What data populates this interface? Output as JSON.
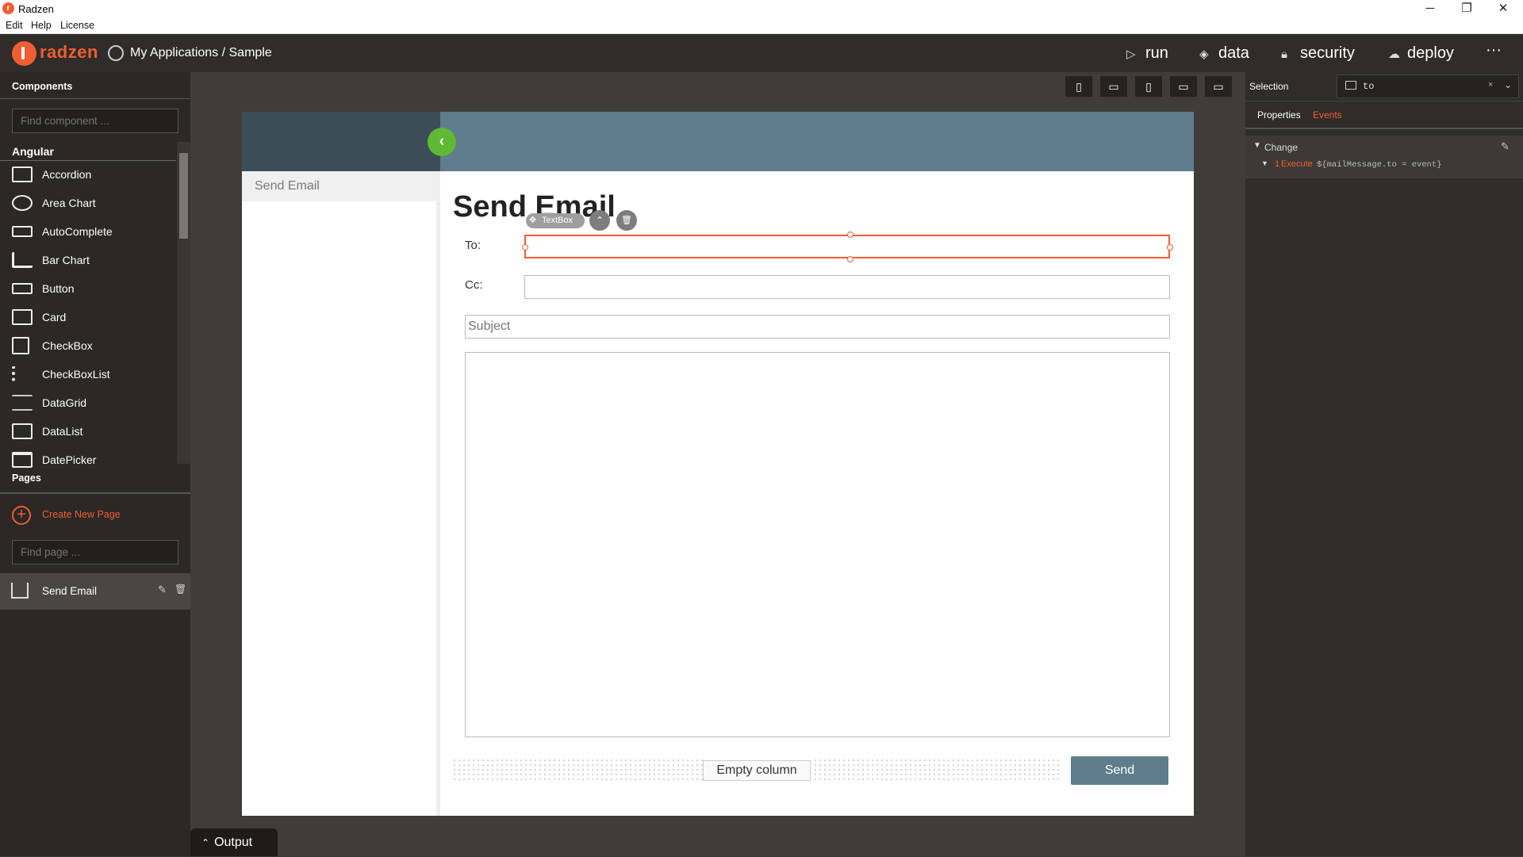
{
  "window": {
    "title": "Radzen",
    "logo_letter": "r",
    "minimize": "─",
    "restore": "❐",
    "close": "✕"
  },
  "menu": {
    "items": [
      "Edit",
      "Help",
      "License"
    ]
  },
  "header": {
    "brand": "radzen",
    "breadcrumb": "My Applications / Sample",
    "nav": [
      {
        "label": "run",
        "icon": "play-icon",
        "glyph": "▷"
      },
      {
        "label": "data",
        "icon": "layers-icon",
        "glyph": "◈"
      },
      {
        "label": "security",
        "icon": "lock-icon",
        "glyph": "🔒︎"
      },
      {
        "label": "deploy",
        "icon": "cloud-upload-icon",
        "glyph": "☁"
      }
    ],
    "more": "···"
  },
  "left": {
    "components_label": "Components",
    "find_component_placeholder": "Find component ...",
    "group_label": "Angular",
    "components": [
      {
        "label": "Accordion",
        "icon": "accordion-icon"
      },
      {
        "label": "Area Chart",
        "icon": "area-chart-icon"
      },
      {
        "label": "AutoComplete",
        "icon": "autocomplete-icon"
      },
      {
        "label": "Bar Chart",
        "icon": "bar-chart-icon"
      },
      {
        "label": "Button",
        "icon": "button-icon"
      },
      {
        "label": "Card",
        "icon": "card-icon"
      },
      {
        "label": "CheckBox",
        "icon": "checkbox-icon"
      },
      {
        "label": "CheckBoxList",
        "icon": "checkbox-list-icon"
      },
      {
        "label": "DataGrid",
        "icon": "datagrid-icon"
      },
      {
        "label": "DataList",
        "icon": "datalist-icon"
      },
      {
        "label": "DatePicker",
        "icon": "datepicker-icon"
      }
    ],
    "pages_label": "Pages",
    "create_new_page": "Create New Page",
    "find_page_placeholder": "Find page ...",
    "pages": [
      {
        "label": "Send Email"
      }
    ]
  },
  "devices": [
    "▯",
    "▭",
    "▯",
    "▭",
    "▭"
  ],
  "canvas": {
    "nav_item": "Send Email",
    "collapse_glyph": "‹",
    "heading": "Send Email",
    "toolbar_label": "TextBox",
    "to_label": "To:",
    "cc_label": "Cc:",
    "subject_placeholder": "Subject",
    "empty_column": "Empty column",
    "send": "Send"
  },
  "right": {
    "selection_label": "Selection",
    "selection_value": "to",
    "tabs": {
      "properties": "Properties",
      "events": "Events"
    },
    "event_name": "Change",
    "action_index": "1",
    "action_type": "Execute",
    "action_code": "${mailMessage.to = event}"
  },
  "output": {
    "label": "Output"
  },
  "colors": {
    "accent": "#ee5e32",
    "send": "#607d8b",
    "collapse": "#5fb934"
  }
}
